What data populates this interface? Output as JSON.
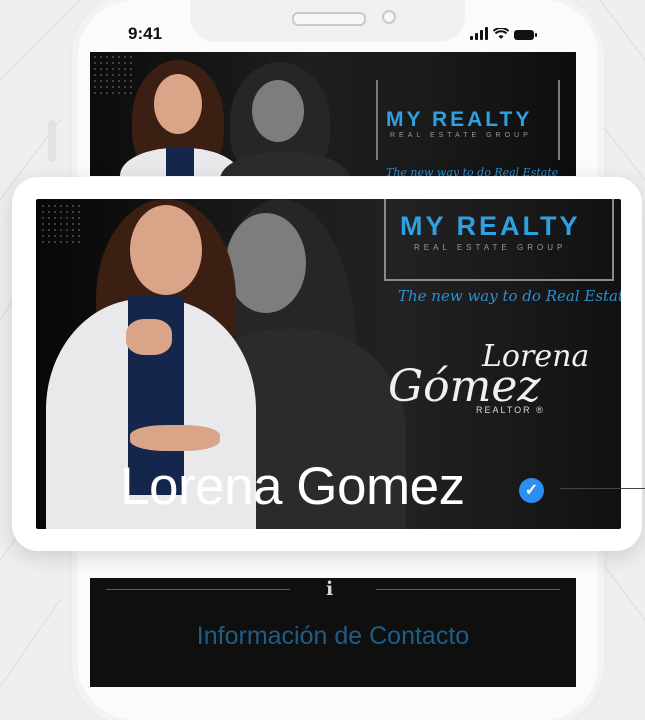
{
  "status_bar": {
    "time": "9:41"
  },
  "brand": {
    "title": "MY REALTY",
    "subtitle": "REAL ESTATE GROUP",
    "tagline": "The new way to do Real Estate",
    "accent_color": "#2fa0e0"
  },
  "signature": {
    "first": "Lorena",
    "last": "Gómez",
    "role": "REALTOR ®"
  },
  "profile": {
    "name": "Lorena Gomez",
    "verified": true,
    "verified_icon": "verified-check-icon",
    "verified_color": "#2c8ef0"
  },
  "contact_section": {
    "icon": "i",
    "title": "Información de Contacto",
    "title_color": "#1e5d87"
  }
}
